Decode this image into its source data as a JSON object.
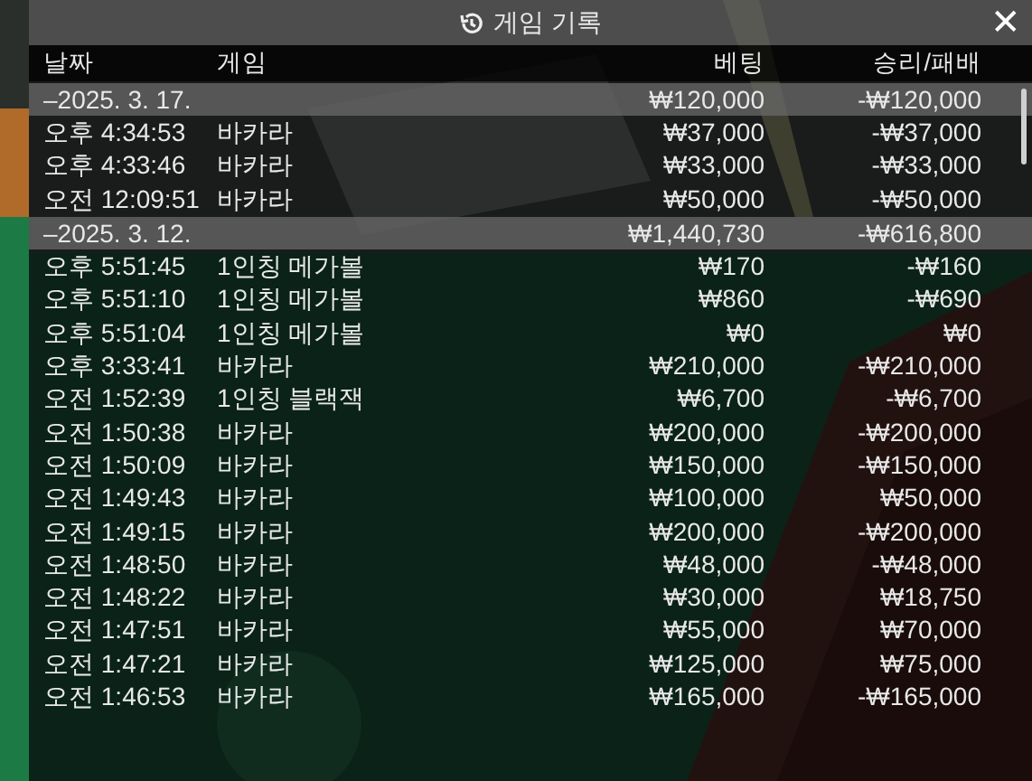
{
  "window": {
    "title": "게임 기록",
    "close": "✕"
  },
  "columns": [
    "날짜",
    "게임",
    "베팅",
    "승리/패배"
  ],
  "groups": [
    {
      "date": "–2025. 3. 17.",
      "bet": "₩120,000",
      "result": "-₩120,000",
      "rows": [
        {
          "time": "오후 4:34:53",
          "game": "바카라",
          "bet": "₩37,000",
          "result": "-₩37,000"
        },
        {
          "time": "오후 4:33:46",
          "game": "바카라",
          "bet": "₩33,000",
          "result": "-₩33,000"
        },
        {
          "time": "오전 12:09:51",
          "game": "바카라",
          "bet": "₩50,000",
          "result": "-₩50,000"
        }
      ]
    },
    {
      "date": "–2025. 3. 12.",
      "bet": "₩1,440,730",
      "result": "-₩616,800",
      "rows": [
        {
          "time": "오후 5:51:45",
          "game": "1인칭 메가볼",
          "bet": "₩170",
          "result": "-₩160"
        },
        {
          "time": "오후 5:51:10",
          "game": "1인칭 메가볼",
          "bet": "₩860",
          "result": "-₩690"
        },
        {
          "time": "오후 5:51:04",
          "game": "1인칭 메가볼",
          "bet": "₩0",
          "result": "₩0"
        },
        {
          "time": "오후 3:33:41",
          "game": "바카라",
          "bet": "₩210,000",
          "result": "-₩210,000"
        },
        {
          "time": "오전 1:52:39",
          "game": "1인칭 블랙잭",
          "bet": "₩6,700",
          "result": "-₩6,700"
        },
        {
          "time": "오전 1:50:38",
          "game": "바카라",
          "bet": "₩200,000",
          "result": "-₩200,000"
        },
        {
          "time": "오전 1:50:09",
          "game": "바카라",
          "bet": "₩150,000",
          "result": "-₩150,000"
        },
        {
          "time": "오전 1:49:43",
          "game": "바카라",
          "bet": "₩100,000",
          "result": "₩50,000"
        },
        {
          "time": "오전 1:49:15",
          "game": "바카라",
          "bet": "₩200,000",
          "result": "-₩200,000"
        },
        {
          "time": "오전 1:48:50",
          "game": "바카라",
          "bet": "₩48,000",
          "result": "-₩48,000"
        },
        {
          "time": "오전 1:48:22",
          "game": "바카라",
          "bet": "₩30,000",
          "result": "₩18,750"
        },
        {
          "time": "오전 1:47:51",
          "game": "바카라",
          "bet": "₩55,000",
          "result": "₩70,000"
        },
        {
          "time": "오전 1:47:21",
          "game": "바카라",
          "bet": "₩125,000",
          "result": "₩75,000"
        },
        {
          "time": "오전 1:46:53",
          "game": "바카라",
          "bet": "₩165,000",
          "result": "-₩165,000"
        }
      ]
    }
  ]
}
